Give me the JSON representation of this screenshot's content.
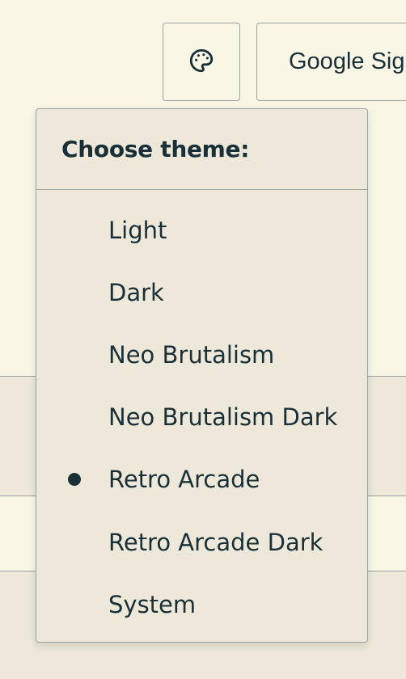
{
  "header": {
    "theme_button_icon": "palette-icon",
    "signin_label": "Google Sig"
  },
  "theme_menu": {
    "title": "Choose theme:",
    "selected": "Retro Arcade",
    "items": [
      {
        "label": "Light",
        "selected": false
      },
      {
        "label": "Dark",
        "selected": false
      },
      {
        "label": "Neo Brutalism",
        "selected": false
      },
      {
        "label": "Neo Brutalism Dark",
        "selected": false
      },
      {
        "label": "Retro Arcade",
        "selected": true
      },
      {
        "label": "Retro Arcade Dark",
        "selected": false
      },
      {
        "label": "System",
        "selected": false
      }
    ]
  },
  "colors": {
    "page_background": "#faf6e6",
    "menu_background": "#ede8d9",
    "border": "#9aa3a4",
    "text": "#1a3038"
  }
}
